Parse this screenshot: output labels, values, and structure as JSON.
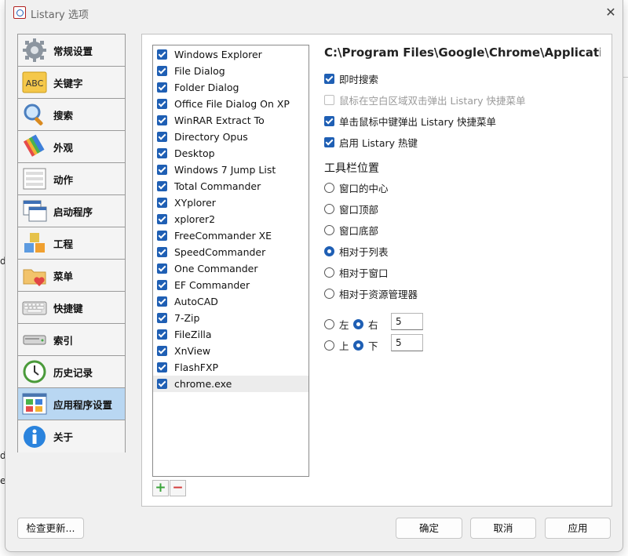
{
  "window": {
    "title": "Listary 选项"
  },
  "background": {
    "fragments": [
      "d",
      "d.",
      "e"
    ]
  },
  "sidebar": {
    "items": [
      {
        "label": "常规设置",
        "icon": "gear-icon"
      },
      {
        "label": "关键字",
        "icon": "abc-icon"
      },
      {
        "label": "搜索",
        "icon": "magnifier-icon"
      },
      {
        "label": "外观",
        "icon": "palette-icon"
      },
      {
        "label": "动作",
        "icon": "action-list-icon"
      },
      {
        "label": "启动程序",
        "icon": "windows-icon"
      },
      {
        "label": "工程",
        "icon": "cubes-icon"
      },
      {
        "label": "菜单",
        "icon": "folder-heart-icon"
      },
      {
        "label": "快捷键",
        "icon": "keyboard-icon"
      },
      {
        "label": "索引",
        "icon": "drive-icon"
      },
      {
        "label": "历史记录",
        "icon": "clock-icon"
      },
      {
        "label": "应用程序设置",
        "icon": "app-grid-icon",
        "active": true
      },
      {
        "label": "关于",
        "icon": "info-icon"
      }
    ]
  },
  "apps": {
    "items": [
      "Windows Explorer",
      "File Dialog",
      "Folder Dialog",
      "Office File Dialog On XP",
      "WinRAR Extract To",
      "Directory Opus",
      "Desktop",
      "Windows 7 Jump List",
      "Total Commander",
      "XYplorer",
      "xplorer2",
      "FreeCommander XE",
      "SpeedCommander",
      "One Commander",
      "EF Commander",
      "AutoCAD",
      "7-Zip",
      "FileZilla",
      "XnView",
      "FlashFXP",
      "chrome.exe"
    ],
    "selected": "chrome.exe",
    "add_icon": "plus-icon",
    "remove_icon": "minus-icon"
  },
  "settings": {
    "path": "C:\\Program Files\\Google\\Chrome\\Applicatio...",
    "options": [
      {
        "label": "即时搜索",
        "checked": true,
        "enabled": true
      },
      {
        "label": "鼠标在空白区域双击弹出 Listary 快捷菜单",
        "checked": false,
        "enabled": false
      },
      {
        "label": "单击鼠标中键弹出 Listary 快捷菜单",
        "checked": true,
        "enabled": true
      },
      {
        "label": "启用 Listary 热键",
        "checked": true,
        "enabled": true
      }
    ],
    "toolbar_position": {
      "title": "工具栏位置",
      "options": [
        "窗口的中心",
        "窗口顶部",
        "窗口底部",
        "相对于列表",
        "相对于窗口",
        "相对于资源管理器"
      ],
      "selected": "相对于列表"
    },
    "horizontal": {
      "left": "左",
      "right": "右",
      "selected": "右",
      "value": "5"
    },
    "vertical": {
      "top": "上",
      "bottom": "下",
      "selected": "下",
      "value": "5"
    }
  },
  "buttons": {
    "check_update": "检查更新...",
    "ok": "确定",
    "cancel": "取消",
    "apply": "应用"
  },
  "colors": {
    "accent": "#1f5fb4",
    "selected_nav": "#b9d7f2"
  }
}
